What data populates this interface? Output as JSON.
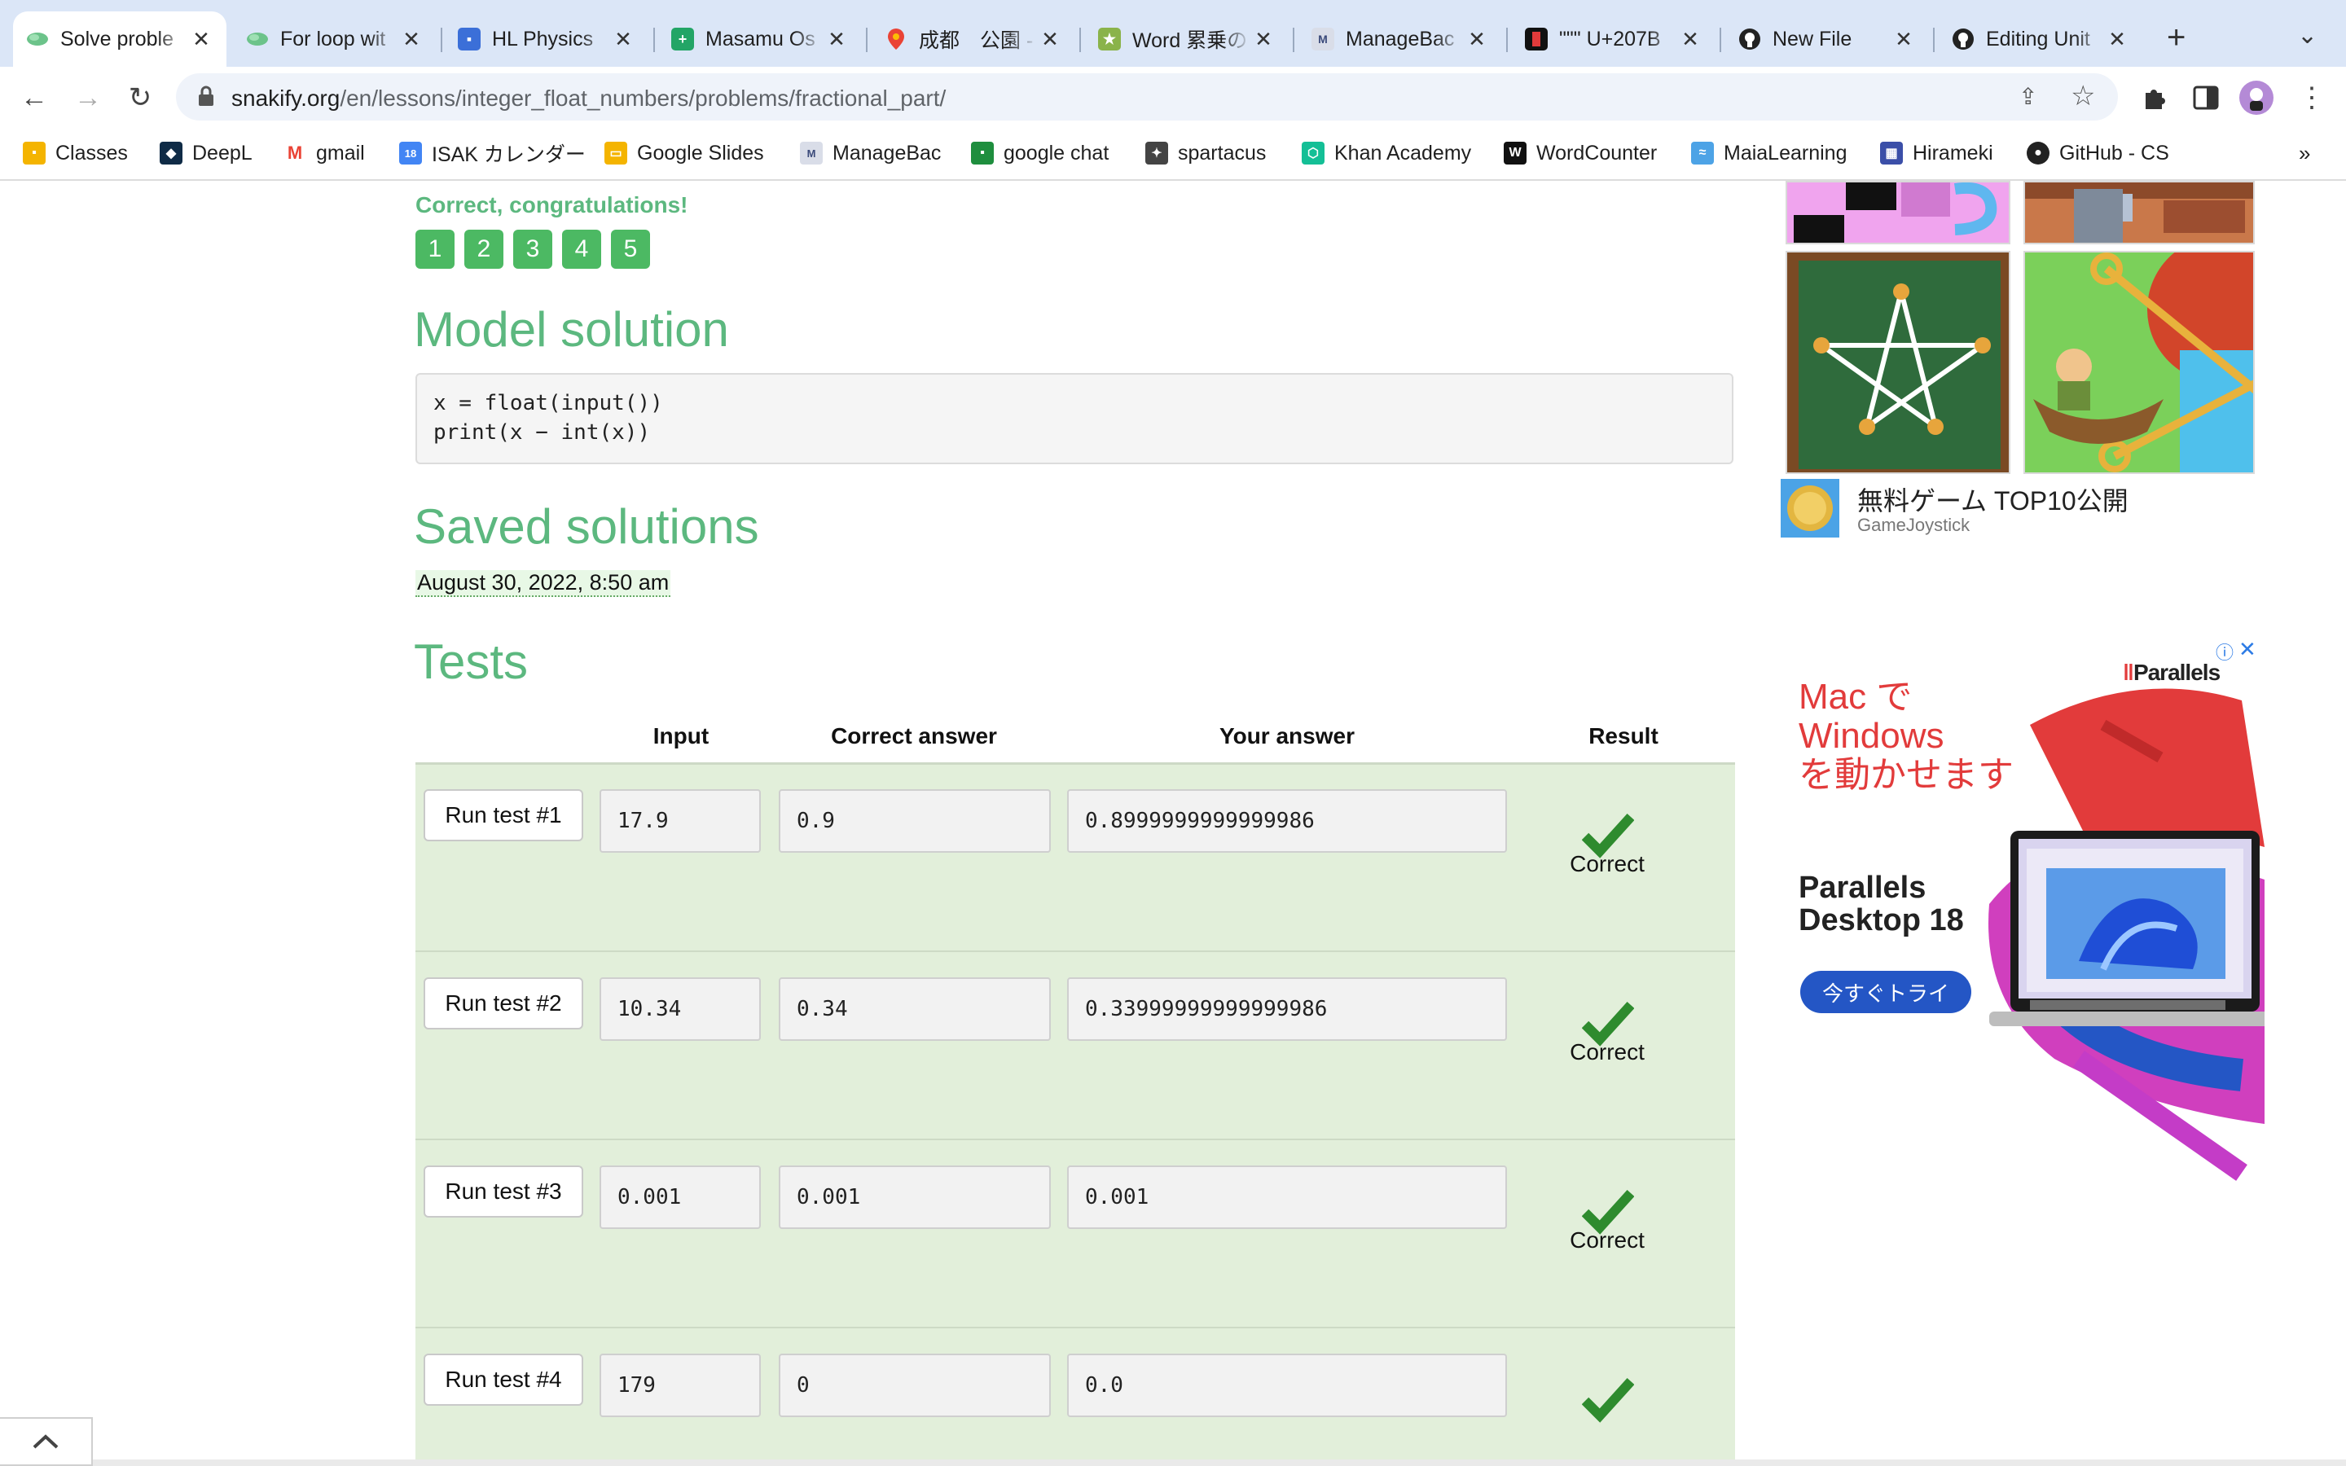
{
  "browser": {
    "tabs": [
      {
        "title": "Solve proble",
        "icon": "snakify-icon",
        "active": true
      },
      {
        "title": "For loop wit",
        "icon": "snakify-icon"
      },
      {
        "title": "HL Physics",
        "icon": "classroom-icon"
      },
      {
        "title": "Masamu Os",
        "icon": "sheets-icon"
      },
      {
        "title": "成都　公園 -",
        "icon": "maps-pin-icon"
      },
      {
        "title": "Word 累乗の",
        "icon": "jp-site-icon"
      },
      {
        "title": "ManageBac",
        "icon": "managebac-icon"
      },
      {
        "title": "\"\"\" U+207B",
        "icon": "unicode-icon"
      },
      {
        "title": "New File",
        "icon": "github-icon"
      },
      {
        "title": "Editing Unit",
        "icon": "github-icon"
      }
    ],
    "url": {
      "host": "snakify.org",
      "path": "/en/lessons/integer_float_numbers/problems/fractional_part/"
    },
    "bookmarks": [
      "Classes",
      "DeepL",
      "gmail",
      "ISAK カレンダー",
      "Google Slides",
      "ManageBac",
      "google chat",
      "spartacus",
      "Khan Academy",
      "WordCounter",
      "MaiaLearning",
      "Hirameki",
      "GitHub - CS"
    ]
  },
  "page": {
    "congrats": "Correct, congratulations!",
    "problem_badges": [
      "1",
      "2",
      "3",
      "4",
      "5"
    ],
    "model_solution_heading": "Model solution",
    "model_code": [
      "x = float(input())",
      "print(x − int(x))"
    ],
    "saved_heading": "Saved solutions",
    "saved_timestamp": "August 30, 2022, 8:50 am",
    "tests_heading": "Tests",
    "columns": {
      "input": "Input",
      "correct": "Correct answer",
      "yours": "Your answer",
      "result": "Result"
    },
    "tests": [
      {
        "button": "Run test #1",
        "input": "17.9",
        "correct": "0.9",
        "yours": "0.8999999999999986",
        "result": "Correct"
      },
      {
        "button": "Run test #2",
        "input": "10.34",
        "correct": "0.34",
        "yours": "0.33999999999999986",
        "result": "Correct"
      },
      {
        "button": "Run test #3",
        "input": "0.001",
        "correct": "0.001",
        "yours": "0.001",
        "result": "Correct"
      },
      {
        "button": "Run test #4",
        "input": "179",
        "correct": "0",
        "yours": "0.0",
        "result": ""
      }
    ]
  },
  "ads": {
    "game_ad": {
      "title": "無料ゲーム TOP10公開",
      "source": "GameJoystick"
    },
    "parallels_ad": {
      "headline": [
        "Mac で",
        "Windows",
        "を動かせます"
      ],
      "product": [
        "Parallels",
        "Desktop 18"
      ],
      "cta": "今すぐトライ",
      "brand": "Parallels"
    }
  },
  "colors": {
    "accent_green": "#5cb87f",
    "badge_green": "#4cb963",
    "check_green": "#2e8b2e",
    "table_bg": "#e2efda",
    "ad_red": "#e23b3b",
    "ad_blue": "#2456c5"
  }
}
